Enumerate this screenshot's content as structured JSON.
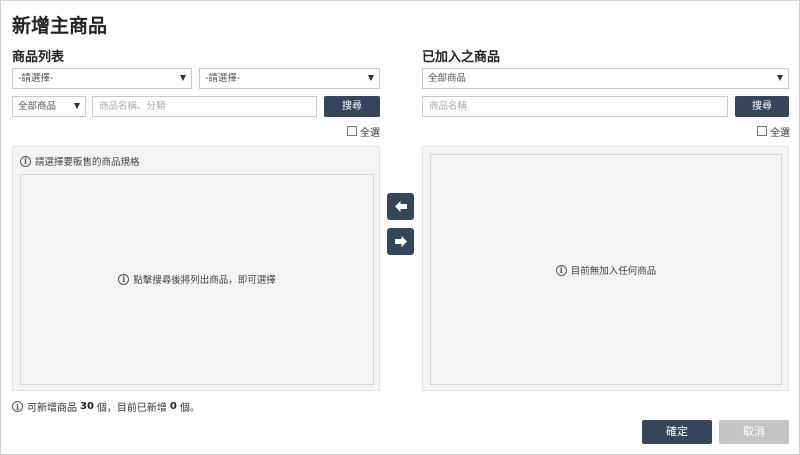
{
  "dialog": {
    "title": "新增主商品"
  },
  "left": {
    "section_label": "商品列表",
    "select1": "-請選擇-",
    "select2": "-請選擇-",
    "category_select": "全部商品",
    "search_placeholder": "商品名稱、分類",
    "search_button": "搜尋",
    "select_all": "全選",
    "hint": "請選擇要販售的商品規格",
    "empty_message": "點擊搜尋後將列出商品，即可選擇"
  },
  "right": {
    "section_label": "已加入之商品",
    "category_select": "全部商品",
    "search_placeholder": "商品名稱",
    "search_button": "搜尋",
    "select_all": "全選",
    "empty_message": "目前無加入任何商品"
  },
  "footer": {
    "note_prefix": "可新增商品",
    "max_count": "30",
    "note_mid": "個，目前已新增",
    "current_count": "0",
    "note_suffix": "個。",
    "confirm_button": "確定",
    "cancel_button": "取消"
  },
  "icons": {
    "info": "info-circle-icon",
    "arrow_left": "arrow-left-icon",
    "arrow_right": "arrow-right-icon",
    "caret": "caret-down-icon"
  },
  "colors": {
    "primary_button": "#35465a",
    "disabled_button": "#c5c5c5",
    "panel_bg": "#f4f4f4"
  }
}
